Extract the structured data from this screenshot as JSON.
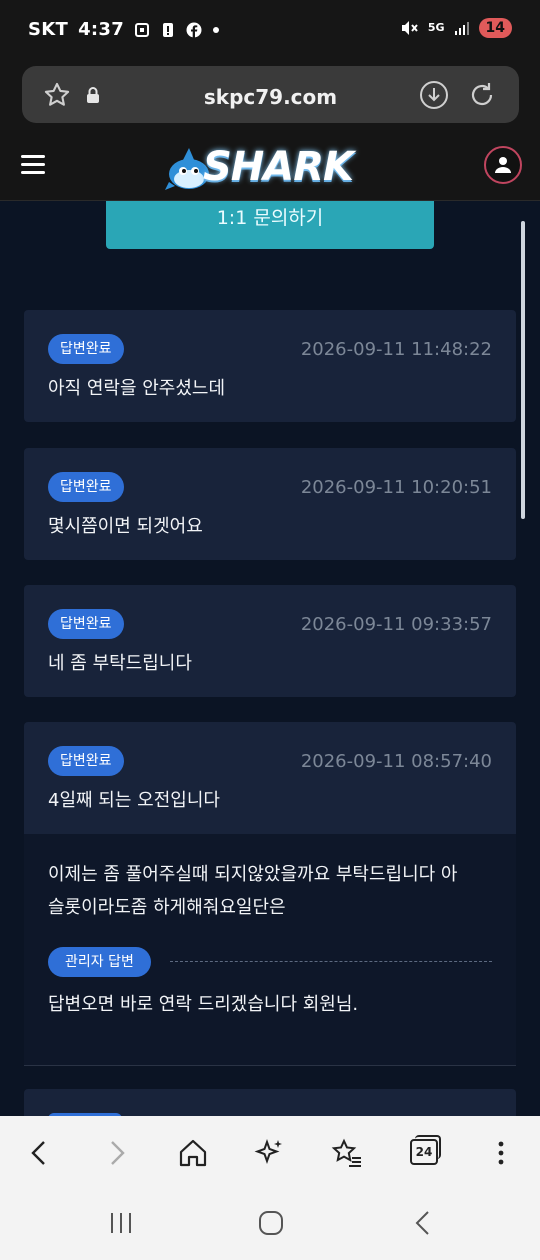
{
  "status_bar": {
    "carrier": "SKT",
    "time": "4:37",
    "network": "5G",
    "battery": "14"
  },
  "browser": {
    "url": "skpc79.com",
    "tab_count": "24"
  },
  "site": {
    "logo_text": "SHARK",
    "inquiry_button": "1:1 문의하기"
  },
  "inquiries": [
    {
      "status": "답변완료",
      "date": "2026-09-11 11:48:22",
      "title": "아직 연락을 안주셨느데"
    },
    {
      "status": "답변완료",
      "date": "2026-09-11 10:20:51",
      "title": "몇시쯤이면 되겟어요"
    },
    {
      "status": "답변완료",
      "date": "2026-09-11 09:33:57",
      "title": "네 좀 부탁드립니다"
    },
    {
      "status": "답변완료",
      "date": "2026-09-11 08:57:40",
      "title": "4일째 되는 오전입니다"
    }
  ],
  "expanded": {
    "question_line1": "이제는 좀 풀어주실때 되지않았을까요 부탁드립니다 아",
    "question_line2": "슬롯이라도좀 하게해줘요일단은",
    "admin_label": "관리자 답변",
    "answer": "답변오면 바로 연락 드리겠습니다 회원님."
  },
  "colors": {
    "background": "#0b1424",
    "card": "#18233a",
    "badge": "#2f6fd7",
    "inquiry_button": "#2aa6b6"
  }
}
